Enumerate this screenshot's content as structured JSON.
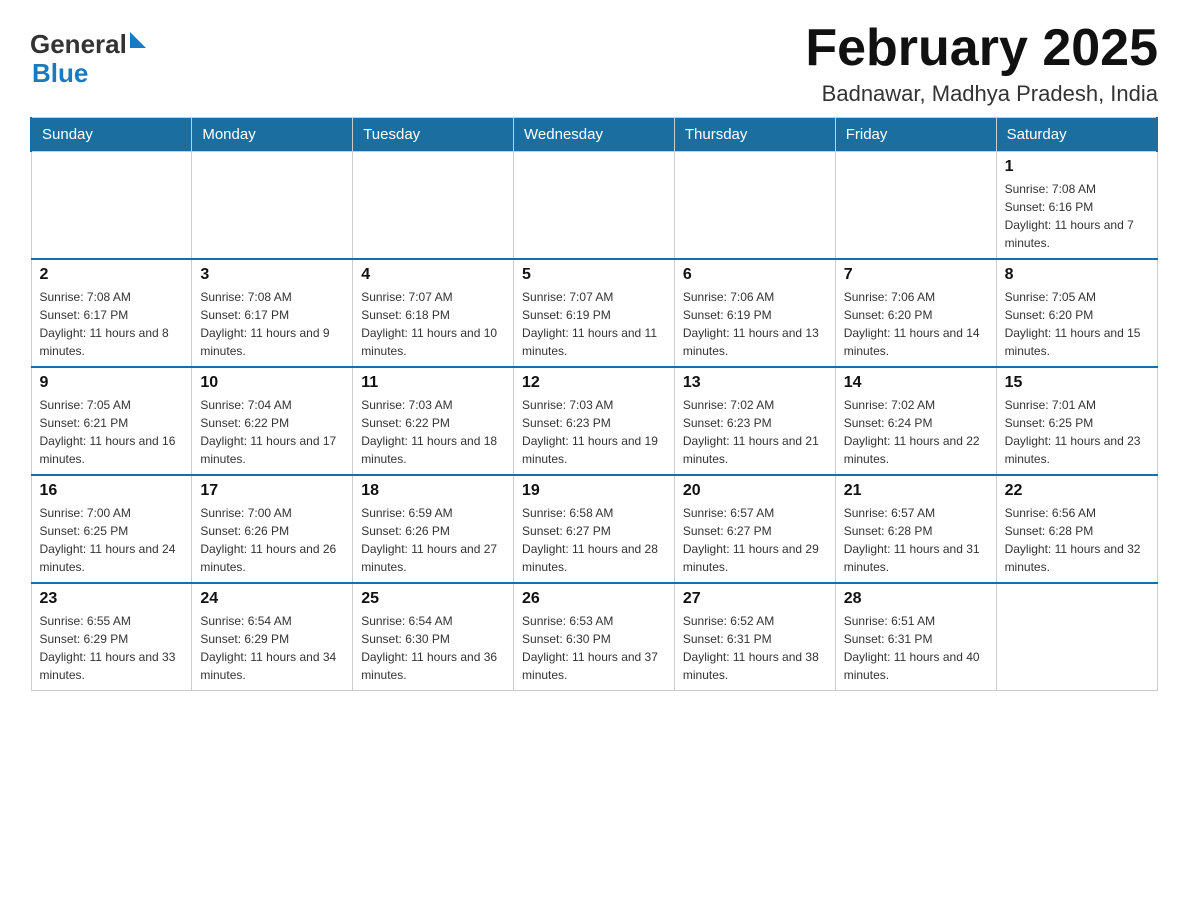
{
  "logo": {
    "general": "General",
    "arrow": "▶",
    "blue": "Blue"
  },
  "title": "February 2025",
  "subtitle": "Badnawar, Madhya Pradesh, India",
  "days_of_week": [
    "Sunday",
    "Monday",
    "Tuesday",
    "Wednesday",
    "Thursday",
    "Friday",
    "Saturday"
  ],
  "weeks": [
    [
      {
        "day": "",
        "info": ""
      },
      {
        "day": "",
        "info": ""
      },
      {
        "day": "",
        "info": ""
      },
      {
        "day": "",
        "info": ""
      },
      {
        "day": "",
        "info": ""
      },
      {
        "day": "",
        "info": ""
      },
      {
        "day": "1",
        "info": "Sunrise: 7:08 AM\nSunset: 6:16 PM\nDaylight: 11 hours and 7 minutes."
      }
    ],
    [
      {
        "day": "2",
        "info": "Sunrise: 7:08 AM\nSunset: 6:17 PM\nDaylight: 11 hours and 8 minutes."
      },
      {
        "day": "3",
        "info": "Sunrise: 7:08 AM\nSunset: 6:17 PM\nDaylight: 11 hours and 9 minutes."
      },
      {
        "day": "4",
        "info": "Sunrise: 7:07 AM\nSunset: 6:18 PM\nDaylight: 11 hours and 10 minutes."
      },
      {
        "day": "5",
        "info": "Sunrise: 7:07 AM\nSunset: 6:19 PM\nDaylight: 11 hours and 11 minutes."
      },
      {
        "day": "6",
        "info": "Sunrise: 7:06 AM\nSunset: 6:19 PM\nDaylight: 11 hours and 13 minutes."
      },
      {
        "day": "7",
        "info": "Sunrise: 7:06 AM\nSunset: 6:20 PM\nDaylight: 11 hours and 14 minutes."
      },
      {
        "day": "8",
        "info": "Sunrise: 7:05 AM\nSunset: 6:20 PM\nDaylight: 11 hours and 15 minutes."
      }
    ],
    [
      {
        "day": "9",
        "info": "Sunrise: 7:05 AM\nSunset: 6:21 PM\nDaylight: 11 hours and 16 minutes."
      },
      {
        "day": "10",
        "info": "Sunrise: 7:04 AM\nSunset: 6:22 PM\nDaylight: 11 hours and 17 minutes."
      },
      {
        "day": "11",
        "info": "Sunrise: 7:03 AM\nSunset: 6:22 PM\nDaylight: 11 hours and 18 minutes."
      },
      {
        "day": "12",
        "info": "Sunrise: 7:03 AM\nSunset: 6:23 PM\nDaylight: 11 hours and 19 minutes."
      },
      {
        "day": "13",
        "info": "Sunrise: 7:02 AM\nSunset: 6:23 PM\nDaylight: 11 hours and 21 minutes."
      },
      {
        "day": "14",
        "info": "Sunrise: 7:02 AM\nSunset: 6:24 PM\nDaylight: 11 hours and 22 minutes."
      },
      {
        "day": "15",
        "info": "Sunrise: 7:01 AM\nSunset: 6:25 PM\nDaylight: 11 hours and 23 minutes."
      }
    ],
    [
      {
        "day": "16",
        "info": "Sunrise: 7:00 AM\nSunset: 6:25 PM\nDaylight: 11 hours and 24 minutes."
      },
      {
        "day": "17",
        "info": "Sunrise: 7:00 AM\nSunset: 6:26 PM\nDaylight: 11 hours and 26 minutes."
      },
      {
        "day": "18",
        "info": "Sunrise: 6:59 AM\nSunset: 6:26 PM\nDaylight: 11 hours and 27 minutes."
      },
      {
        "day": "19",
        "info": "Sunrise: 6:58 AM\nSunset: 6:27 PM\nDaylight: 11 hours and 28 minutes."
      },
      {
        "day": "20",
        "info": "Sunrise: 6:57 AM\nSunset: 6:27 PM\nDaylight: 11 hours and 29 minutes."
      },
      {
        "day": "21",
        "info": "Sunrise: 6:57 AM\nSunset: 6:28 PM\nDaylight: 11 hours and 31 minutes."
      },
      {
        "day": "22",
        "info": "Sunrise: 6:56 AM\nSunset: 6:28 PM\nDaylight: 11 hours and 32 minutes."
      }
    ],
    [
      {
        "day": "23",
        "info": "Sunrise: 6:55 AM\nSunset: 6:29 PM\nDaylight: 11 hours and 33 minutes."
      },
      {
        "day": "24",
        "info": "Sunrise: 6:54 AM\nSunset: 6:29 PM\nDaylight: 11 hours and 34 minutes."
      },
      {
        "day": "25",
        "info": "Sunrise: 6:54 AM\nSunset: 6:30 PM\nDaylight: 11 hours and 36 minutes."
      },
      {
        "day": "26",
        "info": "Sunrise: 6:53 AM\nSunset: 6:30 PM\nDaylight: 11 hours and 37 minutes."
      },
      {
        "day": "27",
        "info": "Sunrise: 6:52 AM\nSunset: 6:31 PM\nDaylight: 11 hours and 38 minutes."
      },
      {
        "day": "28",
        "info": "Sunrise: 6:51 AM\nSunset: 6:31 PM\nDaylight: 11 hours and 40 minutes."
      },
      {
        "day": "",
        "info": ""
      }
    ]
  ]
}
